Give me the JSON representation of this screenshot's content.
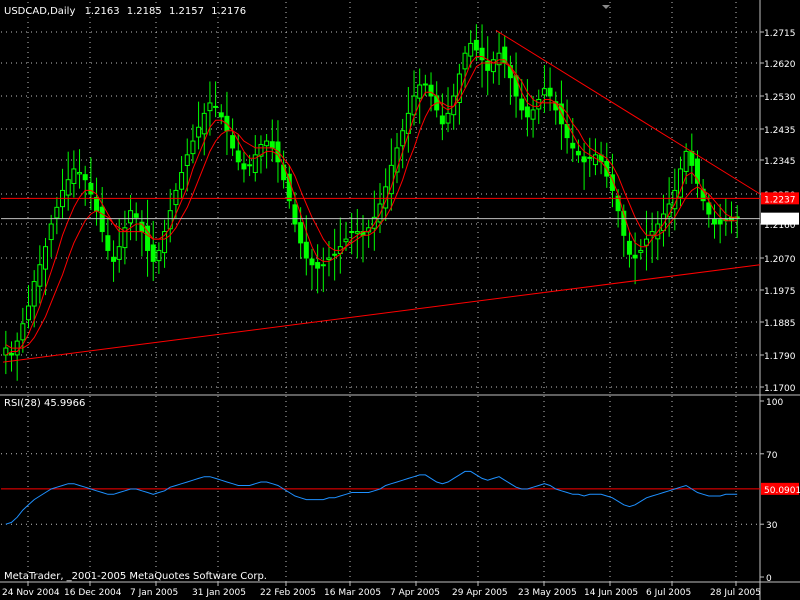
{
  "header": {
    "symbol": "USDCAD,Daily",
    "open": "1.2163",
    "high": "1.2185",
    "low": "1.2157",
    "close": "1.2176"
  },
  "footer": {
    "copyright": "MetaTrader, _2001-2005 MetaQuotes Software Corp."
  },
  "colors": {
    "background": "#000000",
    "grid": "#c0c0c0",
    "candle": "#00ff00",
    "moving_average": "#ff0000",
    "trendline": "#ff0000",
    "rsi_line": "#1e90ff",
    "rsi_level": "#ff0000",
    "current_price_line": "#c0c0c0"
  },
  "chart_data": [
    {
      "type": "candlestick",
      "title": "USDCAD,Daily",
      "ylim": [
        1.17,
        1.275
      ],
      "y_ticks": [
        "1.2715",
        "1.2620",
        "1.2530",
        "1.2435",
        "1.2345",
        "1.2250",
        "1.2160",
        "1.2070",
        "1.1975",
        "1.1885",
        "1.1790",
        "1.1700"
      ],
      "x_ticks": [
        "24 Nov 2004",
        "16 Dec 2004",
        "7 Jan 2005",
        "31 Jan 2005",
        "22 Feb 2005",
        "16 Mar 2005",
        "7 Apr 2005",
        "29 Apr 2005",
        "23 May 2005",
        "14 Jun 2005",
        "6 Jul 2005",
        "28 Jul 2005"
      ],
      "series": [
        {
          "values": [
            1.181,
            1.179,
            1.183,
            1.188,
            1.193,
            1.2,
            1.205,
            1.21,
            1.216,
            1.221,
            1.226,
            1.229,
            1.232,
            1.231,
            1.229,
            1.225,
            1.22,
            1.214,
            1.209,
            1.206,
            1.21,
            1.215,
            1.22,
            1.218,
            1.214,
            1.209,
            1.206,
            1.209,
            1.214,
            1.22,
            1.226,
            1.231,
            1.236,
            1.24,
            1.244,
            1.248,
            1.251,
            1.25,
            1.247,
            1.243,
            1.238,
            1.234,
            1.232,
            1.233,
            1.236,
            1.239,
            1.24,
            1.238,
            1.234,
            1.229,
            1.223,
            1.216,
            1.211,
            1.207,
            1.205,
            1.204,
            1.205,
            1.207,
            1.208,
            1.21,
            1.212,
            1.214,
            1.214,
            1.213,
            1.215,
            1.218,
            1.222,
            1.227,
            1.233,
            1.238,
            1.243,
            1.248,
            1.253,
            1.256,
            1.256,
            1.253,
            1.249,
            1.245,
            1.248,
            1.253,
            1.259,
            1.265,
            1.268,
            1.266,
            1.263,
            1.26,
            1.263,
            1.265,
            1.262,
            1.258,
            1.253,
            1.249,
            1.247,
            1.249,
            1.252,
            1.255,
            1.253,
            1.249,
            1.245,
            1.241,
            1.238,
            1.236,
            1.234,
            1.235,
            1.236,
            1.234,
            1.23,
            1.226,
            1.22,
            1.213,
            1.208,
            1.207,
            1.209,
            1.212,
            1.214,
            1.216,
            1.219,
            1.222,
            1.226,
            1.232,
            1.237,
            1.233,
            1.228,
            1.223,
            1.219,
            1.216,
            1.216,
            1.217,
            1.217,
            1.218
          ]
        }
      ],
      "moving_averages": [
        {
          "values": [
            1.179,
            1.18,
            1.18,
            1.182,
            1.185,
            1.189,
            1.193,
            1.198,
            1.203,
            1.208,
            1.213,
            1.217,
            1.221,
            1.224,
            1.226,
            1.226,
            1.225,
            1.222,
            1.219,
            1.216,
            1.214,
            1.214,
            1.215,
            1.216,
            1.216,
            1.214,
            1.212,
            1.212,
            1.213,
            1.215,
            1.219,
            1.223,
            1.227,
            1.232,
            1.236,
            1.24,
            1.244,
            1.246,
            1.246,
            1.245,
            1.243,
            1.24,
            1.237,
            1.235,
            1.235,
            1.236,
            1.237,
            1.237,
            1.236,
            1.233,
            1.229,
            1.224,
            1.219,
            1.214,
            1.21,
            1.207,
            1.206,
            1.206,
            1.207,
            1.208,
            1.21,
            1.212,
            1.213,
            1.214,
            1.214,
            1.216,
            1.219,
            1.223,
            1.227,
            1.232,
            1.237,
            1.242,
            1.247,
            1.251,
            1.254,
            1.254,
            1.253,
            1.25,
            1.249,
            1.25,
            1.254,
            1.258,
            1.262,
            1.264,
            1.264,
            1.263,
            1.262,
            1.263,
            1.263,
            1.261,
            1.258,
            1.254,
            1.251,
            1.25,
            1.25,
            1.252,
            1.252,
            1.251,
            1.248,
            1.245,
            1.242,
            1.239,
            1.237,
            1.236,
            1.235,
            1.234,
            1.232,
            1.229,
            1.225,
            1.219,
            1.214,
            1.211,
            1.21,
            1.21,
            1.212,
            1.214,
            1.216,
            1.219,
            1.222,
            1.226,
            1.23,
            1.231,
            1.229,
            1.226,
            1.223,
            1.22,
            1.218,
            1.217,
            1.217,
            1.217
          ]
        },
        {
          "values": [
            1.182,
            1.181,
            1.181,
            1.181,
            1.182,
            1.184,
            1.187,
            1.19,
            1.194,
            1.198,
            1.202,
            1.207,
            1.211,
            1.214,
            1.217,
            1.219,
            1.22,
            1.219,
            1.218,
            1.216,
            1.215,
            1.214,
            1.214,
            1.214,
            1.214,
            1.213,
            1.212,
            1.212,
            1.212,
            1.213,
            1.215,
            1.218,
            1.221,
            1.225,
            1.229,
            1.233,
            1.237,
            1.24,
            1.242,
            1.243,
            1.243,
            1.242,
            1.24,
            1.239,
            1.238,
            1.238,
            1.238,
            1.238,
            1.237,
            1.235,
            1.233,
            1.23,
            1.226,
            1.222,
            1.218,
            1.215,
            1.212,
            1.21,
            1.209,
            1.209,
            1.21,
            1.211,
            1.212,
            1.213,
            1.213,
            1.214,
            1.216,
            1.218,
            1.221,
            1.225,
            1.229,
            1.234,
            1.238,
            1.243,
            1.247,
            1.25,
            1.251,
            1.251,
            1.25,
            1.25,
            1.252,
            1.255,
            1.258,
            1.261,
            1.262,
            1.262,
            1.262,
            1.262,
            1.262,
            1.261,
            1.259,
            1.257,
            1.254,
            1.252,
            1.251,
            1.251,
            1.251,
            1.251,
            1.25,
            1.248,
            1.245,
            1.243,
            1.24,
            1.238,
            1.237,
            1.236,
            1.235,
            1.233,
            1.23,
            1.226,
            1.222,
            1.218,
            1.215,
            1.213,
            1.213,
            1.213,
            1.214,
            1.216,
            1.218,
            1.221,
            1.224,
            1.226,
            1.227,
            1.226,
            1.225,
            1.223,
            1.221,
            1.219,
            1.218,
            1.218
          ]
        }
      ],
      "horizontal_lines": [
        {
          "value": 1.2237,
          "label": "1.2237"
        },
        {
          "value": 1.2176,
          "label": "1.2176"
        }
      ],
      "trendlines": [
        {
          "start": [
            "24 Nov 2004",
            1.177
          ],
          "end": [
            "4 Aug 2005",
            1.205
          ]
        },
        {
          "start": [
            "2 May 2005",
            1.272
          ],
          "end": [
            "4 Aug 2005",
            1.225
          ]
        }
      ],
      "grid": true
    },
    {
      "type": "line",
      "title": "RSI(28) 45.9966",
      "ylim": [
        0,
        100
      ],
      "y_ticks": [
        "100",
        "70",
        "50.0901",
        "30",
        "0"
      ],
      "level": {
        "value": 50.0901,
        "label": "50.0901"
      },
      "series": [
        {
          "values": [
            30,
            31,
            34,
            38,
            41,
            44,
            46,
            48,
            50,
            51,
            52,
            53,
            53,
            52,
            51,
            50,
            49,
            48,
            47,
            47,
            48,
            49,
            50,
            50,
            49,
            48,
            47,
            48,
            49,
            51,
            52,
            53,
            54,
            55,
            56,
            57,
            57,
            56,
            55,
            54,
            53,
            52,
            52,
            52,
            53,
            54,
            54,
            53,
            52,
            50,
            48,
            46,
            45,
            44,
            44,
            44,
            44,
            45,
            45,
            46,
            47,
            48,
            48,
            48,
            48,
            49,
            50,
            52,
            53,
            54,
            55,
            56,
            57,
            58,
            58,
            56,
            54,
            53,
            54,
            56,
            58,
            60,
            60,
            58,
            56,
            55,
            56,
            57,
            55,
            53,
            51,
            50,
            50,
            51,
            52,
            53,
            52,
            50,
            49,
            48,
            47,
            47,
            46,
            47,
            47,
            47,
            46,
            45,
            43,
            41,
            40,
            41,
            43,
            45,
            46,
            47,
            48,
            49,
            50,
            51,
            52,
            50,
            48,
            47,
            46,
            46,
            46,
            47,
            47,
            47
          ]
        }
      ],
      "grid": true
    }
  ]
}
